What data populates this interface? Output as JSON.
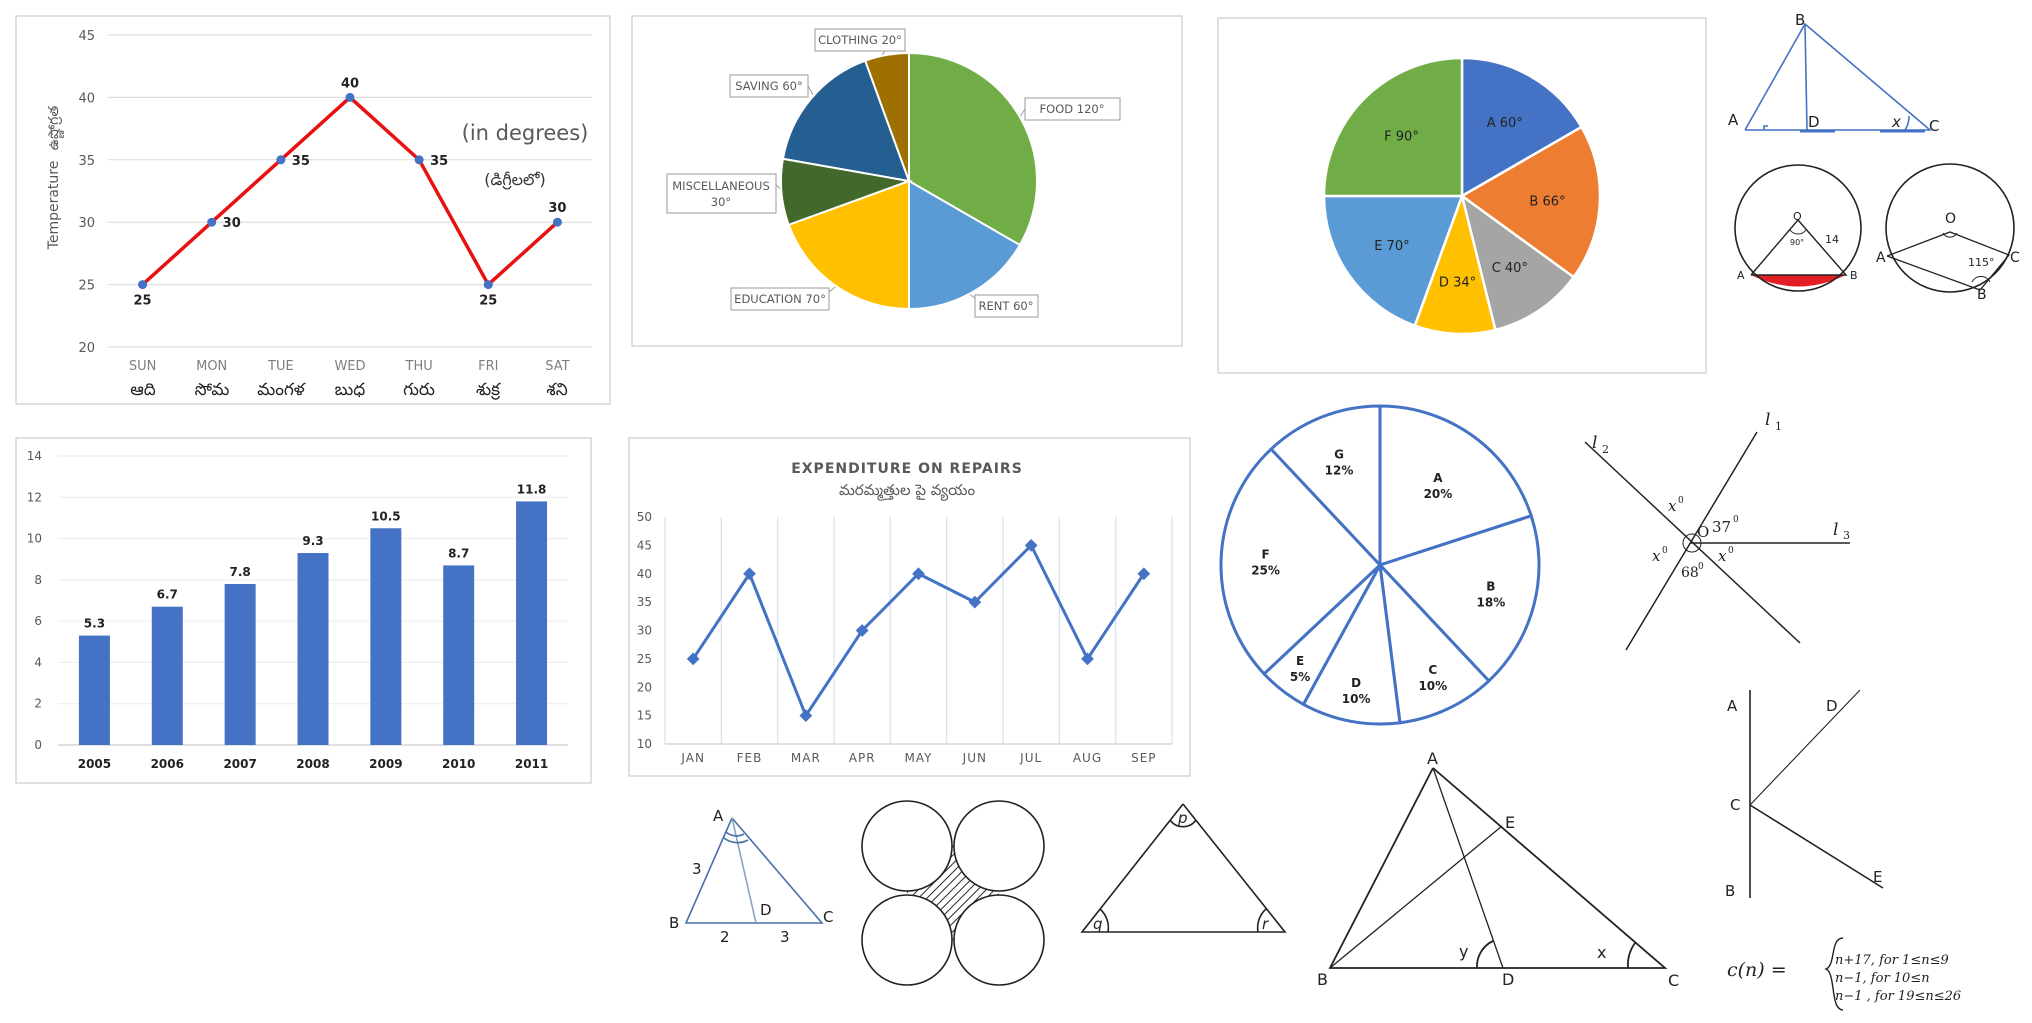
{
  "temp_chart": {
    "ylabel": "Temperature",
    "ylabel_te": "ఉష్ణోగ్రత",
    "note": "(in degrees)",
    "note_te": "(డిగ్రీలలో)",
    "te_days": [
      "ఆది",
      "సోమ",
      "మంగళ",
      "బుధ",
      "గురు",
      "శుక్ర",
      "శని"
    ]
  },
  "pie1": {
    "legend": [
      "FOOD 120°",
      "RENT 60°",
      "EDUCATION 70°",
      "MISCELLANEOUS",
      "30°",
      "SAVING 60°",
      "CLOTHING 20°"
    ]
  },
  "pie2": {
    "labels": [
      "A 60°",
      "B 66°",
      "C 40°",
      "D 34°",
      "E 70°",
      "F 90°"
    ]
  },
  "bar_chart": {
    "xtitle": ""
  },
  "repairs": {
    "title": "EXPENDITURE ON REPAIRS",
    "title_te": "మరమ్మత్తుల పై వ్యయం"
  },
  "pie3": {
    "names": [
      "A",
      "B",
      "C",
      "D",
      "E",
      "F",
      "G"
    ],
    "pcts": [
      "20%",
      "18%",
      "10%",
      "10%",
      "5%",
      "25%",
      "12%"
    ]
  },
  "geometry": {
    "tri_abdc": [
      "B",
      "A",
      "D",
      "x",
      "C"
    ],
    "circle1": [
      "O",
      "14",
      "A",
      "B",
      "90°"
    ],
    "circle2": [
      "O",
      "A",
      "C",
      "B",
      "115°"
    ],
    "lines": [
      "l",
      "2",
      "l",
      "1",
      "l",
      "3",
      "O",
      "37",
      "0",
      "x",
      "0",
      "x",
      "0",
      "x",
      "0",
      "68",
      "0"
    ],
    "tri_abdc2": [
      "A",
      "3",
      "D",
      "B",
      "2",
      "3",
      "C"
    ],
    "tri_pqr": [
      "p",
      "q",
      "r"
    ],
    "big_tri": [
      "A",
      "E",
      "B",
      "D",
      "C",
      "y",
      "x"
    ],
    "angle_fig": [
      "A",
      "D",
      "C",
      "B",
      "E"
    ],
    "formula": {
      "lhs": "c(n) =",
      "lines": [
        "n+17,  for 1≤n≤9",
        "n−1,  for 10≤n",
        "n−1  , for 19≤n≤26"
      ]
    }
  },
  "chart_data": [
    {
      "type": "line",
      "title": "(in degrees)",
      "ylabel": "Temperature",
      "categories": [
        "SUN",
        "MON",
        "TUE",
        "WED",
        "THU",
        "FRI",
        "SAT"
      ],
      "values": [
        25,
        30,
        35,
        40,
        35,
        25,
        30
      ],
      "ylim": [
        20,
        45
      ],
      "yticks": [
        20,
        25,
        30,
        35,
        40,
        45
      ],
      "grid": true,
      "color": "#e81010"
    },
    {
      "type": "pie",
      "title": "",
      "labels": [
        "FOOD",
        "RENT",
        "EDUCATION",
        "MISCELLANEOUS",
        "SAVING",
        "CLOTHING"
      ],
      "values": [
        120,
        60,
        70,
        30,
        60,
        20
      ],
      "colors": [
        "#70ad47",
        "#5b9bd5",
        "#ffc000",
        "#43682b",
        "#255e91",
        "#9e7000"
      ]
    },
    {
      "type": "pie",
      "title": "",
      "labels": [
        "A",
        "B",
        "C",
        "D",
        "E",
        "F"
      ],
      "values": [
        60,
        66,
        40,
        34,
        70,
        90
      ],
      "colors": [
        "#4472c4",
        "#ed7d31",
        "#a5a5a5",
        "#ffc000",
        "#5b9bd5",
        "#70ad47"
      ]
    },
    {
      "type": "bar",
      "title": "",
      "categories": [
        "2005",
        "2006",
        "2007",
        "2008",
        "2009",
        "2010",
        "2011"
      ],
      "values": [
        5.3,
        6.7,
        7.8,
        9.3,
        10.5,
        8.7,
        11.8
      ],
      "ylim": [
        0,
        14
      ],
      "yticks": [
        0,
        2,
        4,
        6,
        8,
        10,
        12,
        14
      ],
      "color": "#4472c4"
    },
    {
      "type": "line",
      "title": "EXPENDITURE ON REPAIRS",
      "categories": [
        "JAN",
        "FEB",
        "MAR",
        "APR",
        "MAY",
        "JUN",
        "JUL",
        "AUG",
        "SEP"
      ],
      "values": [
        25,
        40,
        15,
        30,
        40,
        35,
        45,
        25,
        40
      ],
      "ylim": [
        10,
        50
      ],
      "yticks": [
        10,
        15,
        20,
        25,
        30,
        35,
        40,
        45,
        50
      ],
      "color": "#4472c4"
    },
    {
      "type": "pie",
      "title": "",
      "labels": [
        "A",
        "B",
        "C",
        "D",
        "E",
        "F",
        "G"
      ],
      "values": [
        20,
        18,
        10,
        10,
        5,
        25,
        12
      ]
    }
  ]
}
